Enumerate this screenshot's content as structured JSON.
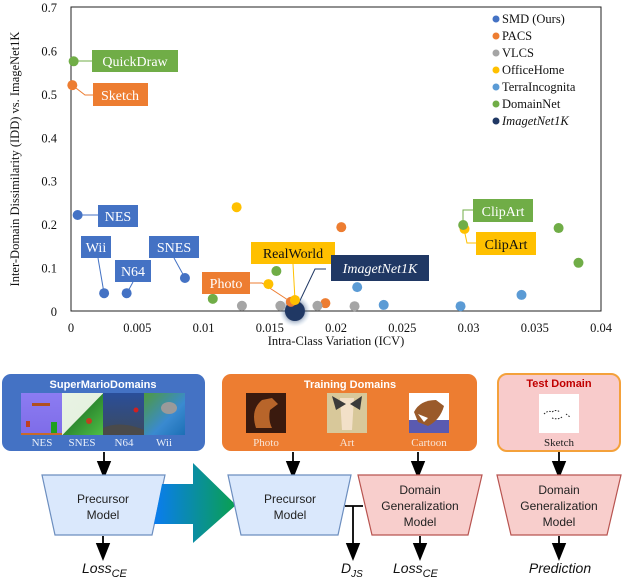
{
  "chart_data": {
    "type": "scatter",
    "title": "",
    "xlabel": "Intra-Class Variation (ICV)",
    "ylabel": "Inter-Domain Dissimilarity (IDD) vs. ImageNet1K",
    "xlim": [
      0,
      0.04
    ],
    "ylim": [
      0,
      0.7
    ],
    "x_ticks": [
      "0",
      "0.005",
      "0.01",
      "0.015",
      "0.02",
      "0.025",
      "0.03",
      "0.035",
      "0.04"
    ],
    "x_tick_values": [
      0,
      0.005,
      0.01,
      0.015,
      0.02,
      0.025,
      0.03,
      0.035,
      0.04
    ],
    "y_ticks": [
      "0",
      "0.1",
      "0.2",
      "0.3",
      "0.4",
      "0.5",
      "0.6",
      "0.7"
    ],
    "y_tick_values": [
      0,
      0.1,
      0.2,
      0.3,
      0.4,
      0.5,
      0.6,
      0.7
    ],
    "grid": false,
    "legend_position": "top-right",
    "series": [
      {
        "name": "SMD (Ours)",
        "color": "#4472C4",
        "italic": false,
        "points": [
          {
            "x": 0.0005,
            "y": 0.221,
            "label": "NES"
          },
          {
            "x": 0.0025,
            "y": 0.041,
            "label": "Wii"
          },
          {
            "x": 0.0042,
            "y": 0.041,
            "label": "N64"
          },
          {
            "x": 0.0086,
            "y": 0.076,
            "label": "SNES"
          }
        ]
      },
      {
        "name": "PACS",
        "color": "#ED7D31",
        "italic": false,
        "points": [
          {
            "x": 0.0001,
            "y": 0.52,
            "label": "Sketch"
          },
          {
            "x": 0.0204,
            "y": 0.193,
            "label": ""
          },
          {
            "x": 0.0166,
            "y": 0.021,
            "label": "Photo"
          },
          {
            "x": 0.0192,
            "y": 0.018,
            "label": ""
          }
        ]
      },
      {
        "name": "VLCS",
        "color": "#A5A5A5",
        "italic": false,
        "points": [
          {
            "x": 0.0129,
            "y": 0.012,
            "label": ""
          },
          {
            "x": 0.0158,
            "y": 0.012,
            "label": ""
          },
          {
            "x": 0.0186,
            "y": 0.012,
            "label": ""
          },
          {
            "x": 0.0214,
            "y": 0.011,
            "label": ""
          }
        ]
      },
      {
        "name": "OfficeHome",
        "color": "#FFC000",
        "italic": false,
        "points": [
          {
            "x": 0.0125,
            "y": 0.239,
            "label": ""
          },
          {
            "x": 0.0149,
            "y": 0.062,
            "label": ""
          },
          {
            "x": 0.0169,
            "y": 0.025,
            "label": "RealWorld"
          },
          {
            "x": 0.0297,
            "y": 0.189,
            "label": "ClipArt"
          }
        ]
      },
      {
        "name": "TerraIncognita",
        "color": "#5B9BD5",
        "italic": false,
        "points": [
          {
            "x": 0.0216,
            "y": 0.055,
            "label": ""
          },
          {
            "x": 0.0236,
            "y": 0.014,
            "label": ""
          },
          {
            "x": 0.0294,
            "y": 0.011,
            "label": ""
          },
          {
            "x": 0.034,
            "y": 0.037,
            "label": ""
          }
        ]
      },
      {
        "name": "DomainNet",
        "color": "#70AD47",
        "italic": false,
        "points": [
          {
            "x": 0.0002,
            "y": 0.575,
            "label": "QuickDraw"
          },
          {
            "x": 0.0107,
            "y": 0.028,
            "label": ""
          },
          {
            "x": 0.0155,
            "y": 0.092,
            "label": ""
          },
          {
            "x": 0.0296,
            "y": 0.198,
            "label": "ClipArt"
          },
          {
            "x": 0.0368,
            "y": 0.191,
            "label": ""
          },
          {
            "x": 0.0383,
            "y": 0.111,
            "label": ""
          }
        ]
      },
      {
        "name": "ImagetNet1K",
        "color": "#203864",
        "italic": true,
        "points": [
          {
            "x": 0.0169,
            "y": 0.0,
            "label": "ImagetNet1K"
          }
        ]
      }
    ]
  },
  "diagram": {
    "smd_box": {
      "title": "SuperMarioDomains",
      "color": "#4472C4",
      "images": [
        {
          "label": "NES",
          "icon": "nes-screenshot-icon"
        },
        {
          "label": "SNES",
          "icon": "snes-screenshot-icon"
        },
        {
          "label": "N64",
          "icon": "n64-screenshot-icon"
        },
        {
          "label": "Wii",
          "icon": "wii-screenshot-icon"
        }
      ]
    },
    "training_box": {
      "title": "Training Domains",
      "color": "#ED7D31",
      "images": [
        {
          "label": "Photo",
          "icon": "horse-photo-icon"
        },
        {
          "label": "Art",
          "icon": "horse-art-icon"
        },
        {
          "label": "Cartoon",
          "icon": "horse-cartoon-icon"
        }
      ]
    },
    "test_box": {
      "title": "Test Domain",
      "title_color": "#C00000",
      "color": "#F8CBCB",
      "border": "#F4A13B",
      "images": [
        {
          "label": "Sketch",
          "icon": "horse-sketch-icon"
        }
      ]
    },
    "precursor_1": {
      "line1": "Precursor",
      "line2": "Model"
    },
    "precursor_2": {
      "line1": "Precursor",
      "line2": "Model"
    },
    "dg_model_1": {
      "line1": "Domain",
      "line2": "Generalization",
      "line3": "Model"
    },
    "dg_model_2": {
      "line1": "Domain",
      "line2": "Generalization",
      "line3": "Model"
    },
    "outputs": {
      "loss1_main": "Loss",
      "loss1_sub": "CE",
      "djs_main": "D",
      "djs_sub": "JS",
      "loss2_main": "Loss",
      "loss2_sub": "CE",
      "prediction": "Prediction"
    }
  }
}
